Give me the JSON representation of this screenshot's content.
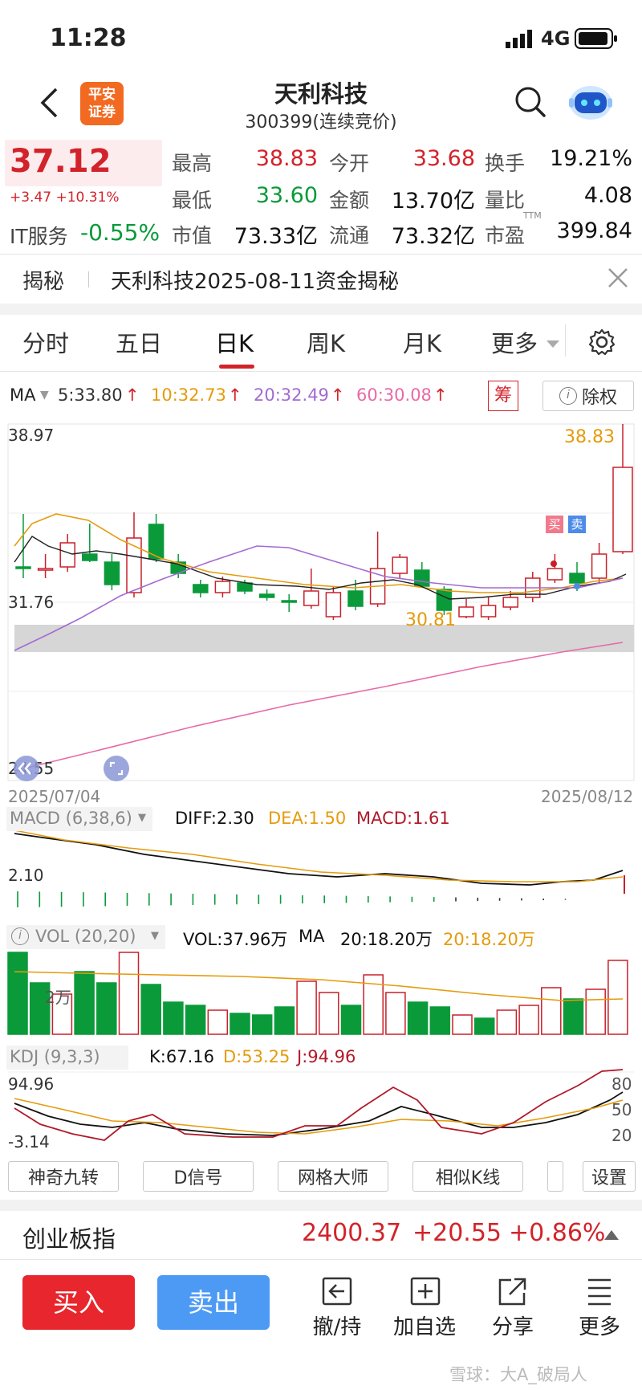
{
  "status_bar": {
    "time": "11:28",
    "network": "4G"
  },
  "header": {
    "logo_text": "平安\n证券",
    "title": "天利科技",
    "subtitle": "300399(连续竞价)"
  },
  "quote": {
    "price": "37.12",
    "change": "+3.47 +10.31%",
    "sector_name": "IT服务",
    "sector_change": "-0.55%",
    "stats": [
      {
        "label": "最高",
        "value": "38.83",
        "color": "red"
      },
      {
        "label": "今开",
        "value": "33.68",
        "color": "red"
      },
      {
        "label": "换手",
        "value": "19.21%",
        "color": "black"
      },
      {
        "label": "最低",
        "value": "33.60",
        "color": "green"
      },
      {
        "label": "金额",
        "value": "13.70亿",
        "color": "black"
      },
      {
        "label": "量比",
        "value": "4.08",
        "color": "black"
      },
      {
        "label": "市值",
        "value": "73.33亿",
        "color": "black"
      },
      {
        "label": "流通",
        "value": "73.32亿",
        "color": "black"
      },
      {
        "label": "市盈",
        "value": "399.84",
        "color": "black",
        "sup": "TTM"
      }
    ]
  },
  "reveal": {
    "tag": "揭秘",
    "text": "天利科技2025-08-11资金揭秘"
  },
  "tabs": [
    "分时",
    "五日",
    "日K",
    "周K",
    "月K",
    "更多"
  ],
  "active_tab": "日K",
  "ma": {
    "label": "MA",
    "ma5": "5:33.80",
    "ma10": "10:32.73",
    "ma20": "20:32.49",
    "ma60": "60:30.08",
    "chip_btn": "筹",
    "exright_btn": "除权"
  },
  "kline": {
    "y_top": "38.97",
    "y_mid": "31.76",
    "y_bottom": "24.55",
    "high_label": "38.83",
    "low_label": "30.81",
    "buy_tag": "买",
    "sell_tag": "卖",
    "date_start": "2025/07/04",
    "date_end": "2025/08/12"
  },
  "macd": {
    "title": "MACD (6,38,6)",
    "diff": "DIFF:2.30",
    "dea": "DEA:1.50",
    "macd": "MACD:1.61",
    "y_label": "2.10"
  },
  "vol": {
    "title": "VOL (20,20)",
    "vol": "VOL:37.96万",
    "ma_label": "MA",
    "ma1": "20:18.20万",
    "ma2": "20:18.20万",
    "y_label": "2万"
  },
  "kdj": {
    "title": "KDJ (9,3,3)",
    "k": "K:67.16",
    "d": "D:53.25",
    "j": "J:94.96",
    "y_top": "94.96",
    "y_bottom": "-3.14",
    "levels": [
      "80",
      "50",
      "20"
    ]
  },
  "tools": [
    "神奇九转",
    "D信号",
    "网格大师",
    "相似K线",
    "设置"
  ],
  "index_bar": {
    "name": "创业板指",
    "value": "2400.37",
    "change": "+20.55",
    "pct": "+0.86%"
  },
  "bottom": {
    "buy": "买入",
    "sell": "卖出",
    "actions": [
      "撤/持",
      "加自选",
      "分享",
      "更多"
    ]
  },
  "watermark": "雪球：大A_破局人",
  "colors": {
    "red": "#d2232a",
    "green": "#0a9a3a",
    "blue": "#4d9af5"
  }
}
